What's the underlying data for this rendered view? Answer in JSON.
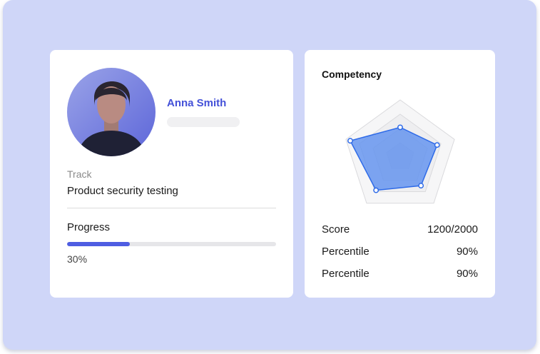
{
  "profile": {
    "name": "Anna Smith",
    "track_label": "Track",
    "track_value": "Product security testing",
    "progress_label": "Progress",
    "progress_percent": 30,
    "progress_text": "30%"
  },
  "competency": {
    "title": "Competency",
    "stats": [
      {
        "label": "Score",
        "value": "1200/2000"
      },
      {
        "label": "Percentile",
        "value": "90%"
      },
      {
        "label": "Percentile",
        "value": "90%"
      }
    ]
  },
  "chart_data": {
    "type": "radar",
    "axes": 5,
    "rings": 4,
    "max": 1,
    "values": [
      0.52,
      0.68,
      0.62,
      0.72,
      0.92
    ]
  },
  "colors": {
    "accent": "#4350d8",
    "frame_bg": "#cfd6f8",
    "radar_fill": "#5b8ef0",
    "radar_stroke": "#2f6be8",
    "progress_fill": "#4e5de2"
  }
}
